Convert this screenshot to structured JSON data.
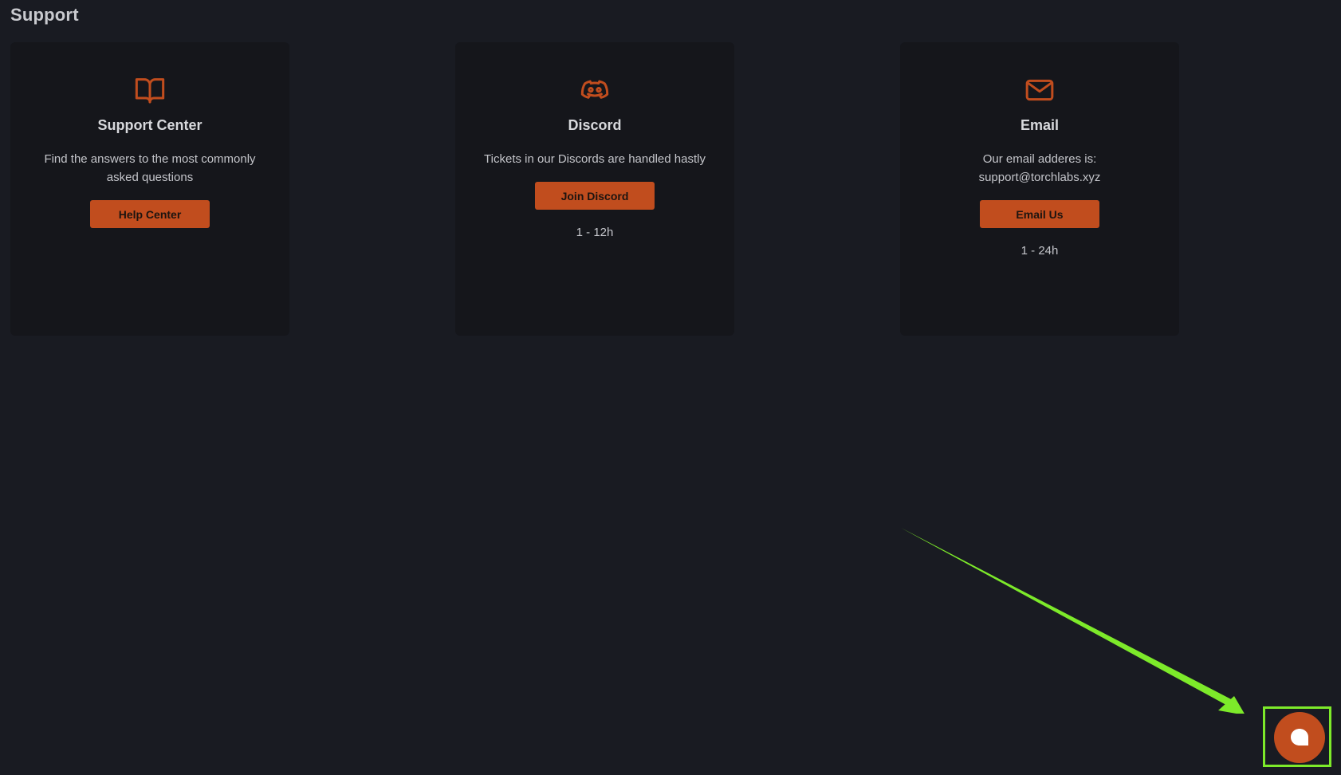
{
  "page": {
    "title": "Support"
  },
  "cards": [
    {
      "icon": "book-open-icon",
      "title": "Support Center",
      "description": "Find the answers to the most commonly asked questions",
      "button_label": "Help Center"
    },
    {
      "icon": "discord-icon",
      "title": "Discord",
      "description": "Tickets in our Discords are handled hastly",
      "button_label": "Join Discord",
      "response_time": "1 - 12h"
    },
    {
      "icon": "mail-icon",
      "title": "Email",
      "description": "Our email adderes is: support@torchlabs.xyz",
      "button_label": "Email Us",
      "response_time": "1 - 24h"
    }
  ],
  "chat_launcher": {
    "icon": "chat-bubble-icon"
  },
  "colors": {
    "background": "#191b22",
    "card_background": "#15161b",
    "accent": "#c14d1e",
    "annotation": "#7dea2a"
  }
}
